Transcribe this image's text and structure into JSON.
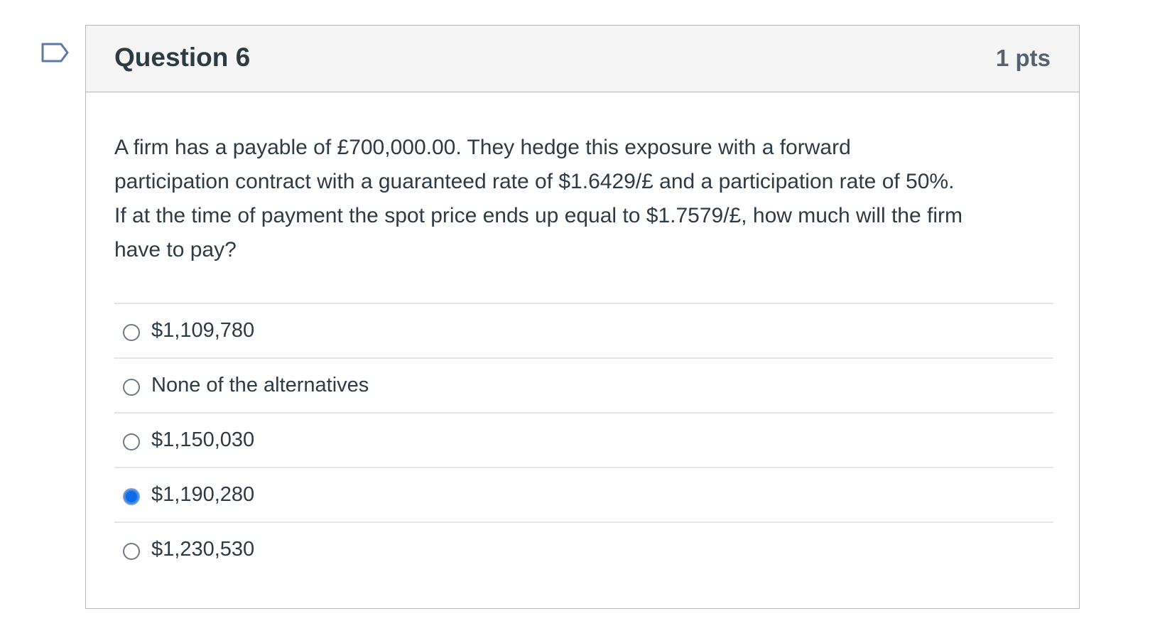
{
  "question": {
    "title": "Question 6",
    "points": "1 pts",
    "text": "A firm has a payable of £700,000.00. They hedge this exposure with a forward participation contract with a guaranteed rate of $1.6429/£ and a participation rate of 50%. If at the time of payment the spot price ends up equal to $1.7579/£, how much will the firm have to pay?",
    "answers": [
      {
        "label": "$1,109,780",
        "selected": false
      },
      {
        "label": "None of the alternatives",
        "selected": false
      },
      {
        "label": "$1,150,030",
        "selected": false
      },
      {
        "label": "$1,190,280",
        "selected": true
      },
      {
        "label": "$1,230,530",
        "selected": false
      }
    ]
  },
  "colors": {
    "selected_radio": "#0f6be6",
    "flag_outline": "#5b7aa6",
    "header_bg": "#f5f5f5"
  },
  "icons": {
    "flag": "flag-question-icon"
  }
}
